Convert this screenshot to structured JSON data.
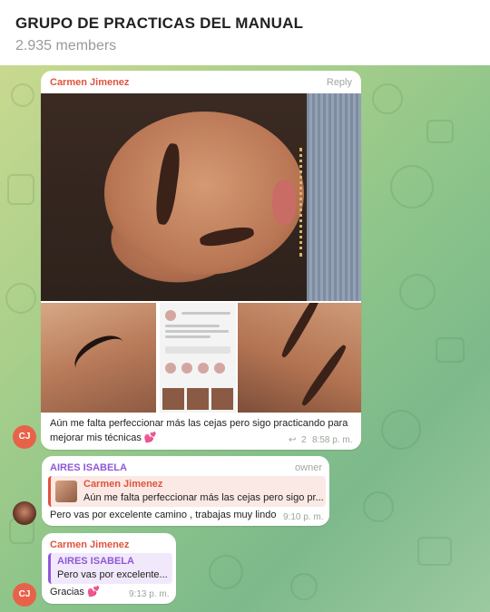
{
  "header": {
    "title": "GRUPO DE PRACTICAS DEL MANUAL",
    "members": "2.935 members"
  },
  "messages": [
    {
      "sender": "Carmen Jimenez",
      "avatar_initials": "CJ",
      "reply_label": "Reply",
      "text": "Aún me falta perfeccionar más las cejas pero sigo practicando para mejorar mis técnicas 💕",
      "replies_count": "2",
      "time": "8:58 p. m."
    },
    {
      "sender": "AIRES ISABELA",
      "role": "owner",
      "quote": {
        "sender": "Carmen Jimenez",
        "text": "Aún me falta perfeccionar más las cejas pero sigo pr..."
      },
      "text": "Pero vas por excelente camino , trabajas muy lindo",
      "time": "9:10 p. m."
    },
    {
      "sender": "Carmen Jimenez",
      "avatar_initials": "CJ",
      "quote": {
        "sender": "AIRES ISABELA",
        "text": "Pero vas por excelente..."
      },
      "text": "Gracias 💕",
      "time": "9:13 p. m."
    }
  ],
  "icons": {
    "reply_arrow": "reply-arrow-icon"
  },
  "colors": {
    "carmen_name": "#e0533c",
    "aires_name": "#8e59d6",
    "avatar_cj": "#e8624a"
  }
}
